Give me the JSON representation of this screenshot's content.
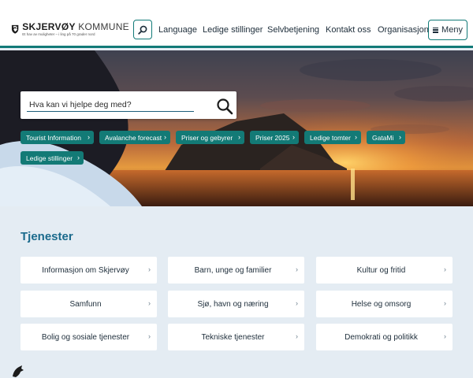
{
  "header": {
    "logo": {
      "name_bold": "SKJERVØY",
      "name_light": "KOMMUNE",
      "tagline": "Et hav av muligheter – i ling på 70 grader nord"
    },
    "nav": [
      {
        "label": "Language"
      },
      {
        "label": "Ledige stillinger"
      },
      {
        "label": "Selvbetjening"
      },
      {
        "label": "Kontakt oss"
      },
      {
        "label": "Organisasjon"
      }
    ],
    "menu_label": "Meny",
    "search_icon": "search-icon"
  },
  "hero": {
    "search_placeholder": "Hva kan vi hjelpe deg med?",
    "quick_links": [
      {
        "label": "Tourist Information"
      },
      {
        "label": "Avalanche forecast"
      },
      {
        "label": "Priser og gebyrer"
      },
      {
        "label": "Priser 2025"
      },
      {
        "label": "Ledige tomter"
      },
      {
        "label": "GataMi"
      },
      {
        "label": "Ledige stillinger"
      }
    ]
  },
  "services": {
    "title": "Tjenester",
    "items": [
      {
        "label": "Informasjon om Skjervøy"
      },
      {
        "label": "Barn, unge og familier"
      },
      {
        "label": "Kultur og fritid"
      },
      {
        "label": "Samfunn"
      },
      {
        "label": "Sjø, havn og næring"
      },
      {
        "label": "Helse og omsorg"
      },
      {
        "label": "Bolig og sosiale tjenester"
      },
      {
        "label": "Tekniske tjenester"
      },
      {
        "label": "Demokrati og politikk"
      }
    ]
  },
  "colors": {
    "accent": "#127a78",
    "chip": "#137a76",
    "title": "#1a6a8c",
    "page_bg": "#e4ecf3"
  },
  "chevron": "›"
}
